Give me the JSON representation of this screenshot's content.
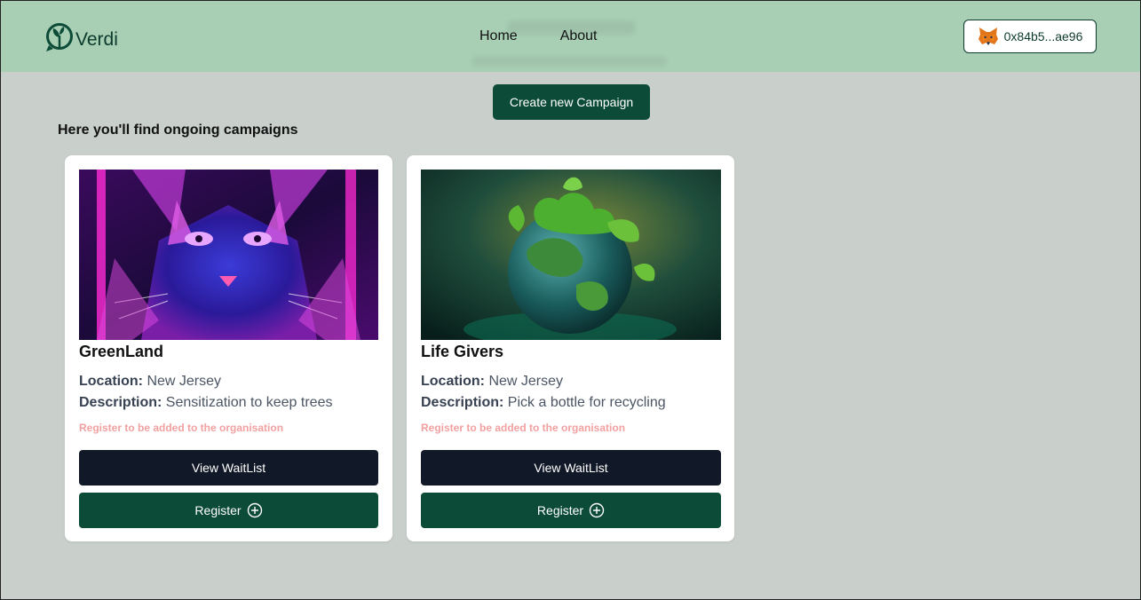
{
  "app": {
    "name": "Verdi"
  },
  "nav": {
    "items": [
      "Home",
      "About"
    ]
  },
  "wallet": {
    "address": "0x84b5...ae96",
    "icon": "metamask-fox-icon"
  },
  "actions": {
    "create_label": "Create new Campaign"
  },
  "intro": {
    "text": "Here you'll find ongoing campaigns"
  },
  "campaigns": [
    {
      "title": "GreenLand",
      "location_label": "Location:",
      "location": "New Jersey",
      "description_label": "Description:",
      "description": "Sensitization to keep trees",
      "note": "Register to be added to the organisation",
      "waitlist_label": "View WaitList",
      "register_label": "Register"
    },
    {
      "title": "Life Givers",
      "location_label": "Location:",
      "location": "New Jersey",
      "description_label": "Description:",
      "description": "Pick a bottle for recycling",
      "note": "Register to be added to the organisation",
      "waitlist_label": "View WaitList",
      "register_label": "Register"
    }
  ],
  "colors": {
    "header_bg": "#a8cfb4",
    "page_bg": "#c9cfcb",
    "primary": "#0c4b37",
    "dark": "#111827",
    "note": "#f2a0a0"
  }
}
